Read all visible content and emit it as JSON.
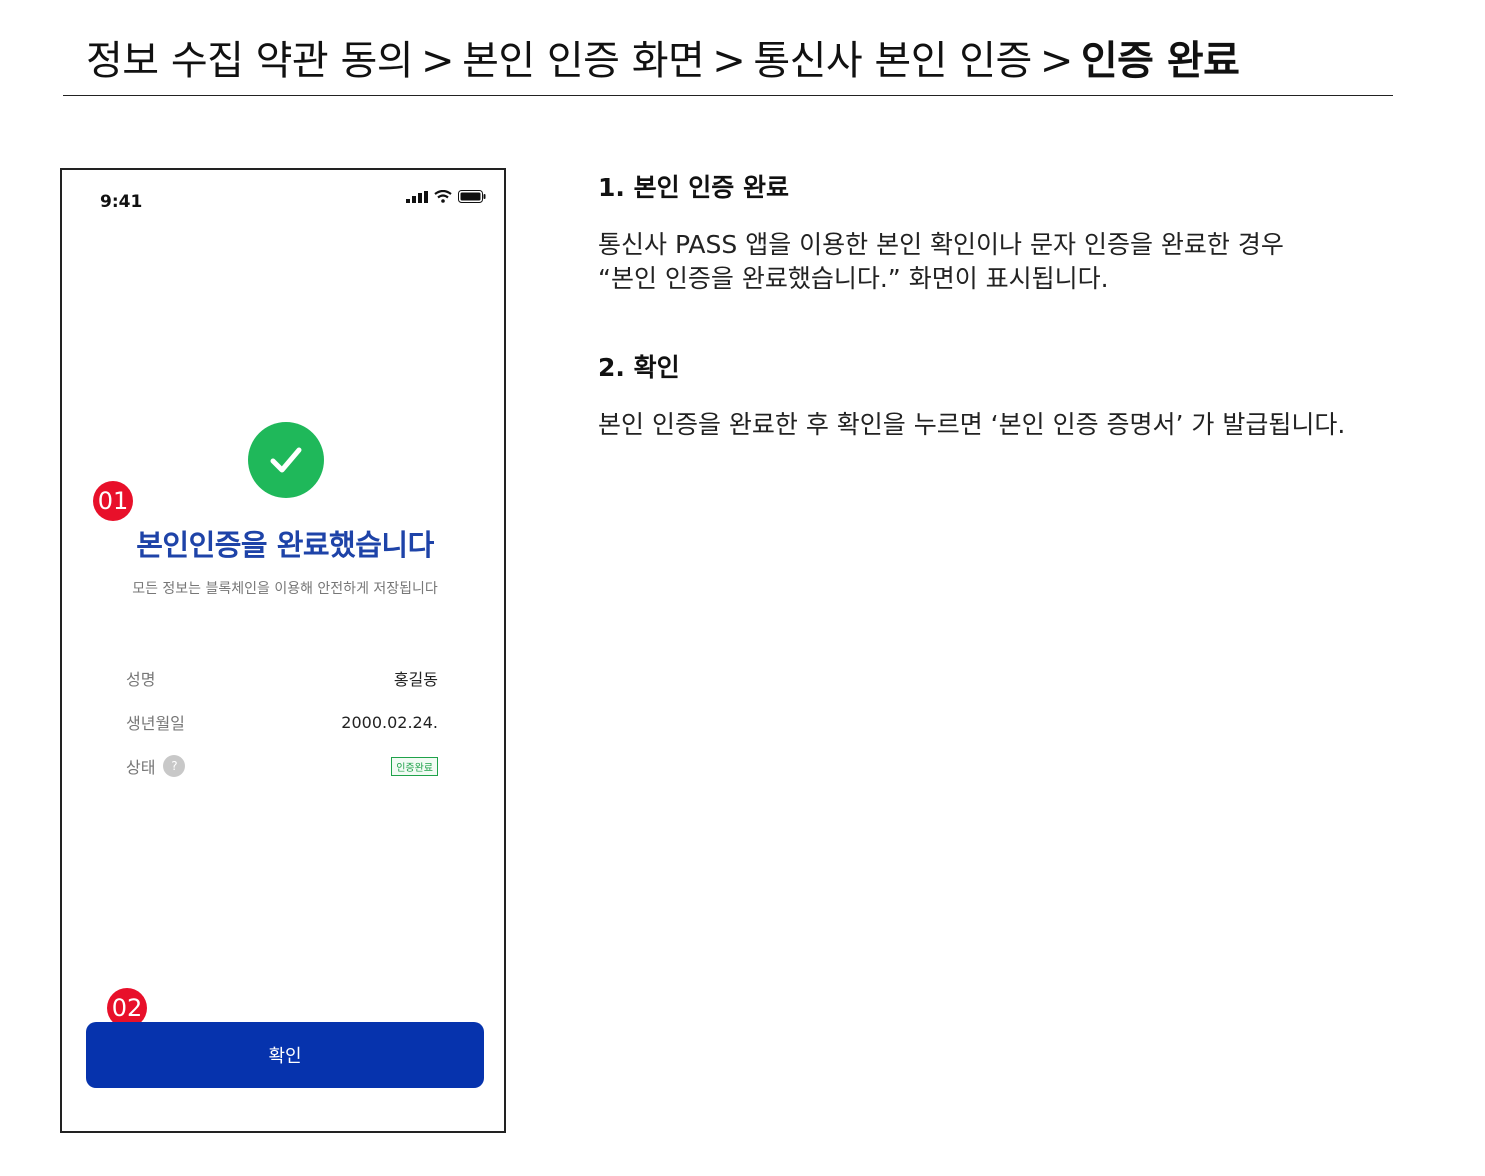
{
  "breadcrumb": {
    "steps": [
      "정보 수집 약관 동의",
      "본인 인증 화면",
      "통신사 본인 인증"
    ],
    "separator": ">",
    "current": "인증 완료"
  },
  "phone": {
    "status_time": "9:41",
    "title": "본인인증을 완료했습니다",
    "subtitle": "모든 정보는 블록체인을 이용해 안전하게 저장됩니다",
    "rows": [
      {
        "label": "성명",
        "value": "홍길동"
      },
      {
        "label": "생년월일",
        "value": "2000.02.24."
      },
      {
        "label": "상태",
        "help": "?",
        "badge": "인증완료"
      }
    ],
    "confirm_label": "확인",
    "markers": [
      "01",
      "02"
    ]
  },
  "descriptions": [
    {
      "heading": "1. 본인 인증 완료",
      "lines": [
        "통신사 PASS 앱을 이용한 본인 확인이나 문자 인증을 완료한 경우",
        "“본인 인증을 완료했습니다.” 화면이 표시됩니다."
      ]
    },
    {
      "heading": "2. 확인",
      "lines": [
        "본인 인증을 완료한 후 확인을 누르면 ‘본인 인증 증명서’ 가 발급됩니다."
      ]
    }
  ],
  "colors": {
    "accent_blue": "#0633ad",
    "title_blue": "#1e43a8",
    "success_green": "#1fb85a",
    "marker_red": "#e8102a"
  }
}
